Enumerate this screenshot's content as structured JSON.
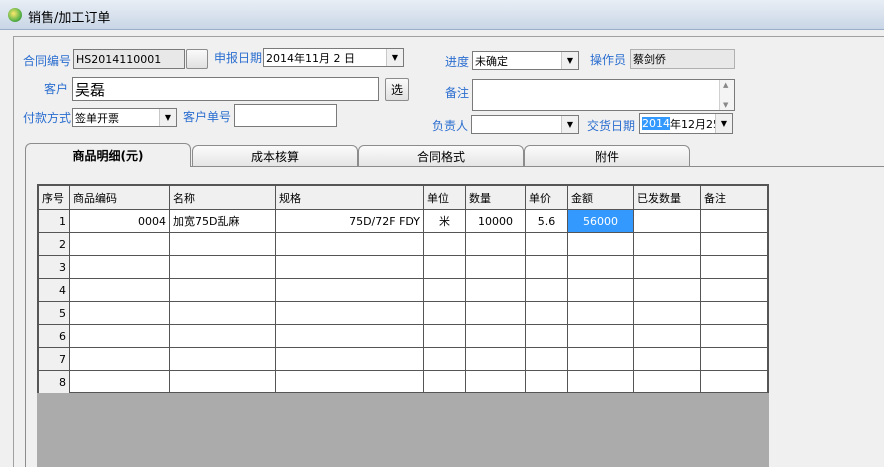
{
  "window": {
    "title": "销售/加工订单"
  },
  "form": {
    "contract_no_label": "合同编号",
    "contract_no_value": "HS2014110001",
    "report_date_label": "申报日期",
    "report_date_value": "2014年11月 2 日",
    "progress_label": "进度",
    "progress_value": "未确定",
    "operator_label": "操作员",
    "operator_value": "蔡剑侨",
    "customer_label": "客户",
    "customer_value": "吴磊",
    "select_button": "选",
    "remark_label": "备注",
    "remark_value": "",
    "payment_label": "付款方式",
    "payment_value": "签单开票",
    "customer_order_label": "客户单号",
    "customer_order_value": "",
    "manager_label": "负责人",
    "manager_value": "",
    "delivery_label": "交货日期",
    "delivery_year_sel": "2014",
    "delivery_rest": "年12月25"
  },
  "tabs": [
    {
      "label": "商品明细(元)"
    },
    {
      "label": "成本核算"
    },
    {
      "label": "合同格式"
    },
    {
      "label": "附件"
    }
  ],
  "table": {
    "headers": [
      "序号",
      "商品编码",
      "名称",
      "规格",
      "单位",
      "数量",
      "单价",
      "金额",
      "已发数量",
      "备注"
    ],
    "rows": [
      [
        "1",
        "0004",
        "加宽75D乱麻",
        "75D/72F FDY",
        "米",
        "10000",
        "5.6",
        "56000",
        "",
        ""
      ],
      [
        "2",
        "",
        "",
        "",
        "",
        "",
        "",
        "",
        "",
        ""
      ],
      [
        "3",
        "",
        "",
        "",
        "",
        "",
        "",
        "",
        "",
        ""
      ],
      [
        "4",
        "",
        "",
        "",
        "",
        "",
        "",
        "",
        "",
        ""
      ],
      [
        "5",
        "",
        "",
        "",
        "",
        "",
        "",
        "",
        "",
        ""
      ],
      [
        "6",
        "",
        "",
        "",
        "",
        "",
        "",
        "",
        "",
        ""
      ],
      [
        "7",
        "",
        "",
        "",
        "",
        "",
        "",
        "",
        "",
        ""
      ],
      [
        "8",
        "",
        "",
        "",
        "",
        "",
        "",
        "",
        "",
        ""
      ]
    ]
  }
}
